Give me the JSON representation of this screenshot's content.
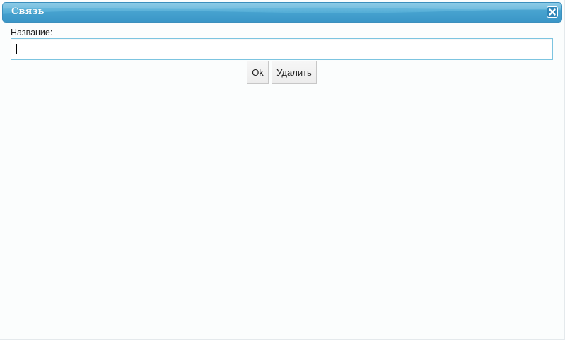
{
  "dialog": {
    "title": "Связь",
    "close_icon": "close-icon"
  },
  "form": {
    "name_label": "Название:",
    "name_value": "",
    "name_placeholder": ""
  },
  "buttons": {
    "ok_label": "Ok",
    "delete_label": "Удалить"
  },
  "colors": {
    "titlebar_top": "#7cc4e4",
    "titlebar_bottom": "#3a95c6",
    "input_border": "#7cc4e0",
    "dialog_background": "#fbfdfd"
  }
}
